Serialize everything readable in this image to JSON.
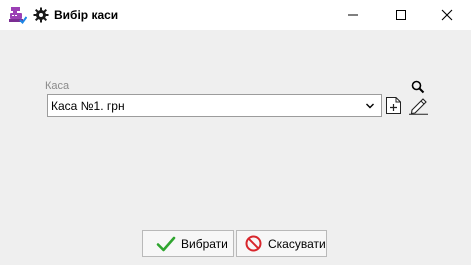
{
  "window": {
    "title": "Вибір каси",
    "controls": {
      "minimize": "minimize-icon",
      "maximize": "maximize-icon",
      "close": "close-icon"
    }
  },
  "form": {
    "cash_label": "Каса",
    "cash_value": "Каса №1. грн"
  },
  "actions": {
    "ok_label": "Вибрати",
    "cancel_label": "Скасувати"
  },
  "colors": {
    "accent_purple": "#9b3fb5",
    "ok_green": "#2fa52f",
    "cancel_red": "#d8262c",
    "title_bg": "#ffffff",
    "body_bg": "#efefef"
  }
}
